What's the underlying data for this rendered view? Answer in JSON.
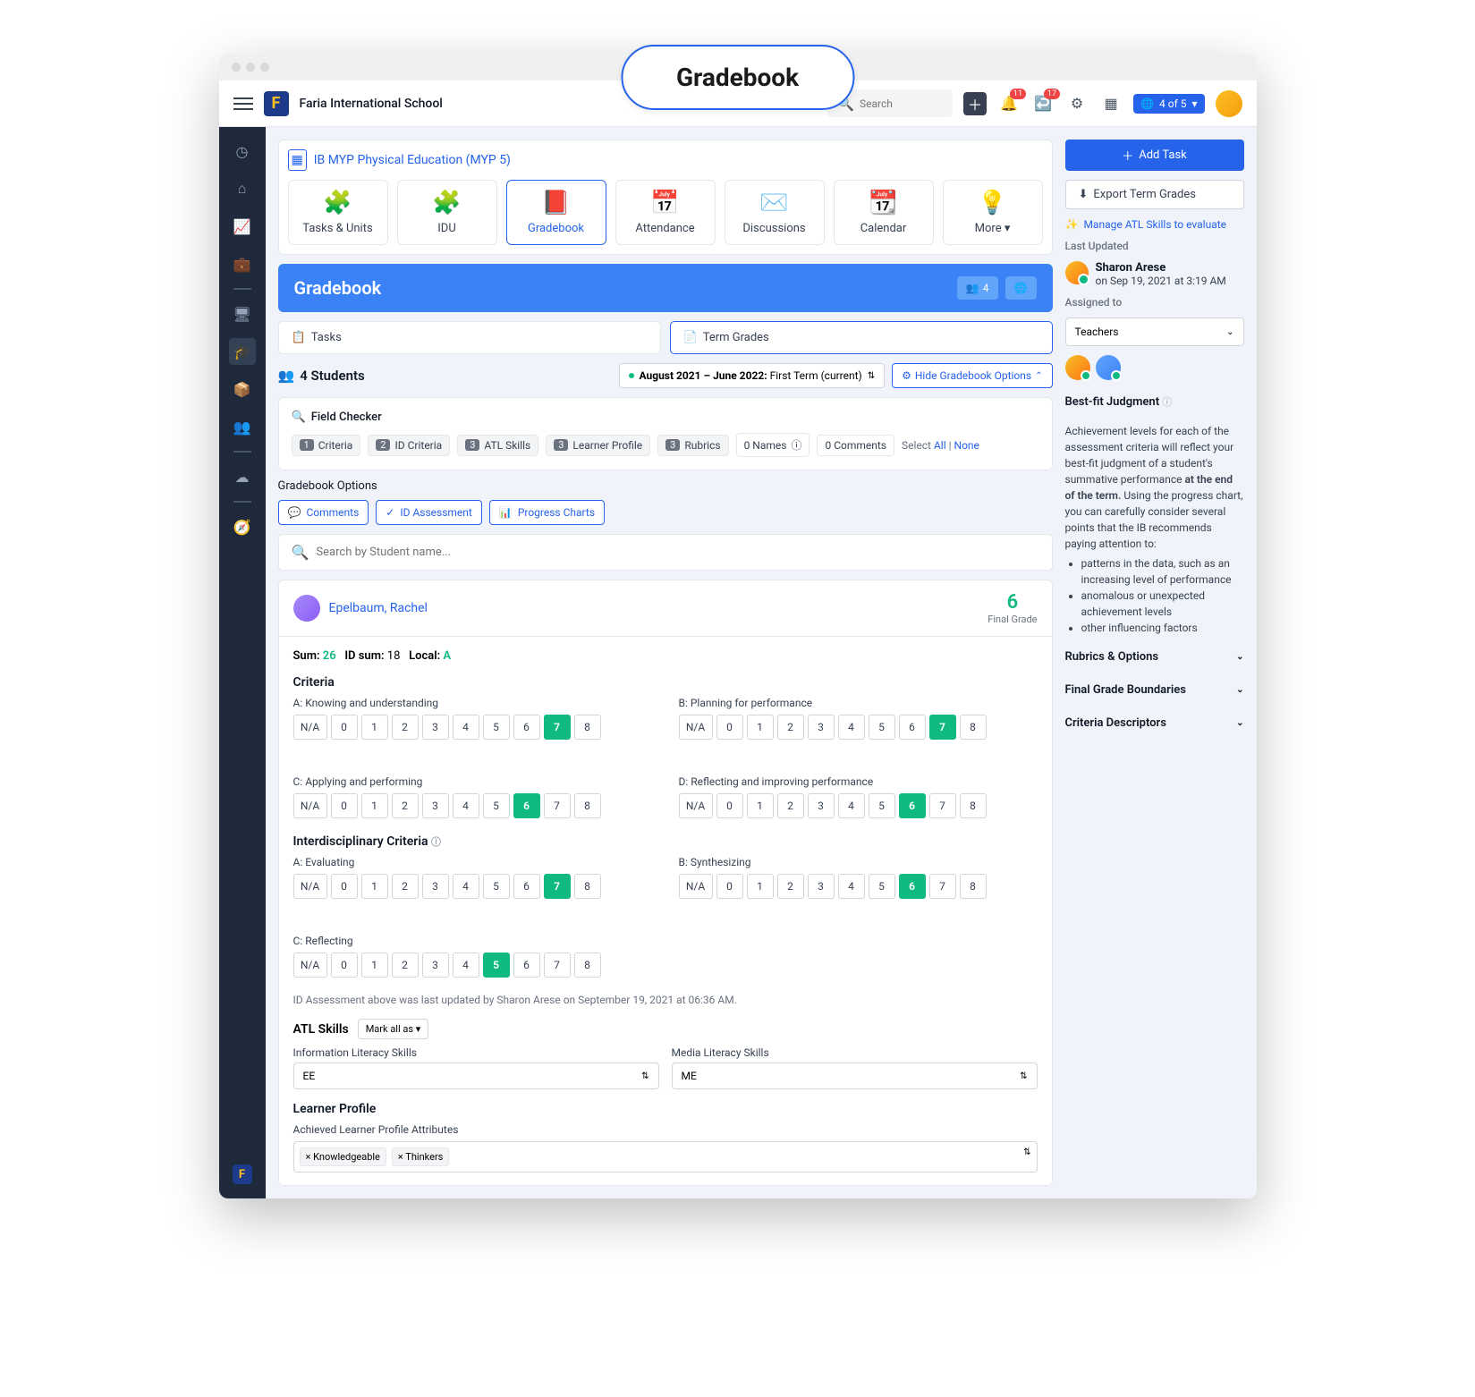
{
  "floatingBadge": "Gradebook",
  "header": {
    "schoolName": "Faria International School",
    "searchPlaceholder": "Search",
    "bellCount": "11",
    "msgCount": "17",
    "schoolPill": "4 of 5"
  },
  "breadcrumb": "IB MYP Physical Education (MYP 5)",
  "navCards": [
    {
      "label": "Tasks & Units",
      "icon": "🧩"
    },
    {
      "label": "IDU",
      "icon": "🧩"
    },
    {
      "label": "Gradebook",
      "icon": "📕"
    },
    {
      "label": "Attendance",
      "icon": "📅"
    },
    {
      "label": "Discussions",
      "icon": "✉️"
    },
    {
      "label": "Calendar",
      "icon": "📆"
    },
    {
      "label": "More",
      "icon": "💡"
    }
  ],
  "blueHeader": {
    "title": "Gradebook",
    "count": "4"
  },
  "tabs": {
    "tasks": "Tasks",
    "termGrades": "Term Grades"
  },
  "studentsBar": {
    "count": "4 Students",
    "termPrefix": "August 2021 – June 2022:",
    "termSuffix": " First Term (current)",
    "hideBtn": "Hide Gradebook Options"
  },
  "fieldChecker": {
    "title": "Field Checker",
    "chips": [
      {
        "n": "1",
        "l": "Criteria"
      },
      {
        "n": "2",
        "l": "ID Criteria"
      },
      {
        "n": "3",
        "l": "ATL Skills"
      },
      {
        "n": "3",
        "l": "Learner Profile"
      },
      {
        "n": "3",
        "l": "Rubrics"
      }
    ],
    "namesChip": "0 Names",
    "commentsChip": "0 Comments",
    "selectText": "Select ",
    "allLink": "All",
    "sep": " | ",
    "noneLink": "None"
  },
  "gradebookOptions": {
    "title": "Gradebook Options",
    "btns": [
      "Comments",
      "ID Assessment",
      "Progress Charts"
    ]
  },
  "searchStudentPlaceholder": "Search by Student name...",
  "student": {
    "name": "Epelbaum, Rachel",
    "finalGrade": "6",
    "finalGradeLabel": "Final Grade",
    "sumLabel": "Sum:",
    "sumValue": "26",
    "idSumLabel": "ID sum:",
    "idSumValue": "18",
    "localLabel": "Local:",
    "localValue": "A",
    "criteriaTitle": "Criteria",
    "interTitle": "Interdisciplinary Criteria",
    "criteria": [
      {
        "label": "A: Knowing and understanding",
        "selected": 7
      },
      {
        "label": "B: Planning for performance",
        "selected": 7
      },
      {
        "label": "C: Applying and performing",
        "selected": 6
      },
      {
        "label": "D: Reflecting and improving performance",
        "selected": 6
      }
    ],
    "inter": [
      {
        "label": "A: Evaluating",
        "selected": 7
      },
      {
        "label": "B: Synthesizing",
        "selected": 6
      },
      {
        "label": "C: Reflecting",
        "selected": 5
      }
    ],
    "idNote": "ID Assessment above was last updated by Sharon Arese on September 19, 2021 at 06:36 AM.",
    "atlTitle": "ATL Skills",
    "markAllBtn": "Mark all as",
    "atl1Label": "Information Literacy Skills",
    "atl1Value": "EE",
    "atl2Label": "Media Literacy Skills",
    "atl2Value": "ME",
    "lpTitle": "Learner Profile",
    "lpSub": "Achieved Learner Profile Attributes",
    "lpTags": [
      "× Knowledgeable",
      "× Thinkers"
    ]
  },
  "right": {
    "addTask": "Add Task",
    "exportGrades": "Export Term Grades",
    "manageLink": "Manage ATL Skills to evaluate",
    "lastUpdatedLabel": "Last Updated",
    "updatedName": "Sharon Arese",
    "updatedTime": "on Sep 19, 2021 at 3:19 AM",
    "assignedLabel": "Assigned to",
    "assignedDropdown": "Teachers",
    "bestFitTitle": "Best-fit Judgment",
    "bestFitText1": "Achievement levels for each of the assessment criteria will reflect your best-fit judgment of a student's summative performance ",
    "bestFitBold": "at the end of the term.",
    "bestFitText2": " Using the progress chart, you can carefully consider several points that the IB recommends paying attention to:",
    "bullets": [
      "patterns in the data, such as an increasing level of performance",
      "anomalous or unexpected achievement levels",
      "other influencing factors"
    ],
    "accordions": [
      "Rubrics & Options",
      "Final Grade Boundaries",
      "Criteria Descriptors"
    ]
  }
}
